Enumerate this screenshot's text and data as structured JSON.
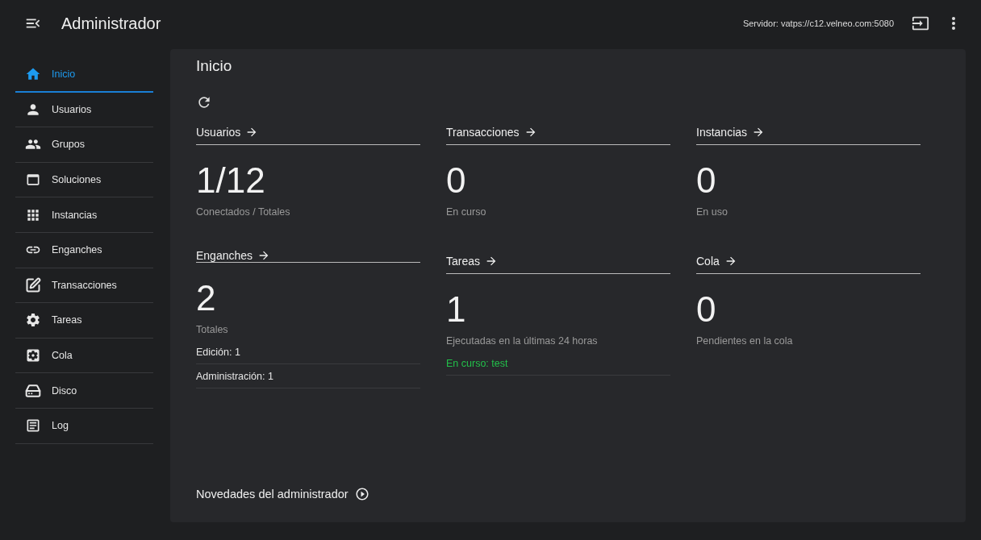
{
  "header": {
    "title": "Administrador",
    "server": "Servidor: vatps://c12.velneo.com:5080"
  },
  "sidebar": {
    "items": [
      {
        "label": "Inicio",
        "selected": true
      },
      {
        "label": "Usuarios",
        "selected": false
      },
      {
        "label": "Grupos",
        "selected": false
      },
      {
        "label": "Soluciones",
        "selected": false
      },
      {
        "label": "Instancias",
        "selected": false
      },
      {
        "label": "Enganches",
        "selected": false
      },
      {
        "label": "Transacciones",
        "selected": false
      },
      {
        "label": "Tareas",
        "selected": false
      },
      {
        "label": "Cola",
        "selected": false
      },
      {
        "label": "Disco",
        "selected": false
      },
      {
        "label": "Log",
        "selected": false
      }
    ]
  },
  "main": {
    "title": "Inicio",
    "cards": [
      {
        "title": "Usuarios",
        "value": "1/12",
        "caption": "Conectados / Totales"
      },
      {
        "title": "Transacciones",
        "value": "0",
        "caption": "En curso"
      },
      {
        "title": "Instancias",
        "value": "0",
        "caption": "En uso"
      },
      {
        "title": "Enganches",
        "value": "2",
        "caption": "Totales",
        "details": [
          {
            "text": "Edición: 1",
            "kind": "plain"
          },
          {
            "text": "Administración: 1",
            "kind": "plain"
          }
        ]
      },
      {
        "title": "Tareas",
        "value": "1",
        "caption": "Ejecutadas en la últimas 24 horas",
        "details": [
          {
            "text": "En curso: test",
            "kind": "running"
          }
        ]
      },
      {
        "title": "Cola",
        "value": "0",
        "caption": "Pendientes en la cola"
      }
    ],
    "news": "Novedades del administrador"
  }
}
